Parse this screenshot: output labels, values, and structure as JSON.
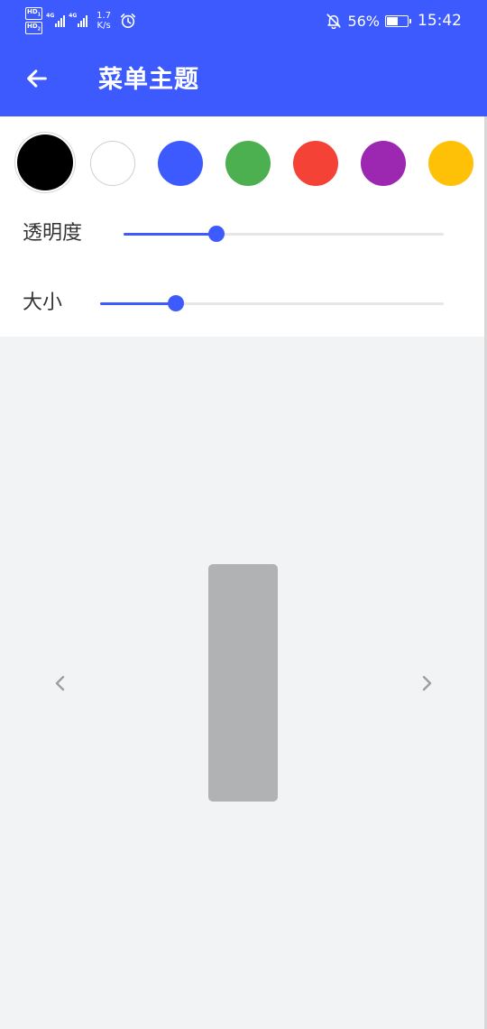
{
  "status_bar": {
    "sim1_label": "HD",
    "sim1_index": "1",
    "sim2_label": "HD",
    "sim2_index": "2",
    "network1": "4G",
    "network2": "4G",
    "net_speed_value": "1.7",
    "net_speed_unit": "K/s",
    "battery_percent_text": "56%",
    "battery_level": 0.56,
    "time": "15:42",
    "icons": [
      "hd-sim1-icon",
      "hd-sim2-icon",
      "signal-4g-icon",
      "signal-4g-icon",
      "alarm-clock-icon",
      "bell-off-icon",
      "battery-icon"
    ]
  },
  "app_bar": {
    "title": "菜单主题",
    "back_icon": "arrow-left-icon",
    "background": "#3D5AFE"
  },
  "color_options": [
    {
      "name": "black",
      "hex": "#000000",
      "selected": true
    },
    {
      "name": "white",
      "hex": "#FFFFFF",
      "selected": false
    },
    {
      "name": "blue",
      "hex": "#3D5AFE",
      "selected": false
    },
    {
      "name": "green",
      "hex": "#4CAF50",
      "selected": false
    },
    {
      "name": "red",
      "hex": "#F44336",
      "selected": false
    },
    {
      "name": "purple",
      "hex": "#9C27B0",
      "selected": false
    },
    {
      "name": "amber",
      "hex": "#FFC107",
      "selected": false
    }
  ],
  "sliders": {
    "opacity": {
      "label": "透明度",
      "value": 0.29
    },
    "size": {
      "label": "大小",
      "value": 0.22
    }
  },
  "preview": {
    "prev_icon": "chevron-left-icon",
    "next_icon": "chevron-right-icon",
    "menu_color": "#B1B2B4"
  },
  "colors": {
    "accent": "#3D5AFE",
    "track": "#E6E6E6",
    "background": "#F2F3F5",
    "card": "#FFFFFF"
  }
}
